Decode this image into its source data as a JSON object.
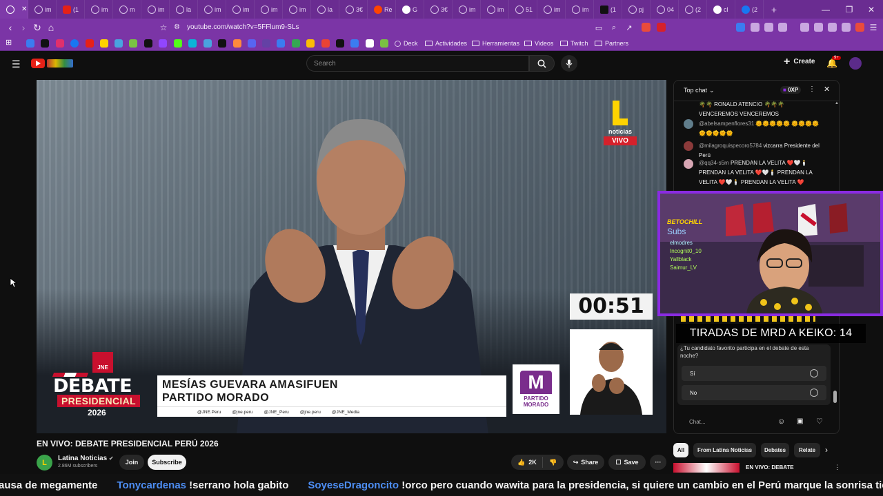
{
  "browser": {
    "tabs": [
      {
        "label": "",
        "icon": "app-icon",
        "active": true
      },
      {
        "label": "im",
        "icon": "globe-icon"
      },
      {
        "label": "(1",
        "icon": "youtube-icon"
      },
      {
        "label": "im",
        "icon": "globe-icon"
      },
      {
        "label": "m",
        "icon": "globe-icon"
      },
      {
        "label": "im",
        "icon": "globe-icon"
      },
      {
        "label": "la",
        "icon": "globe-icon"
      },
      {
        "label": "im",
        "icon": "globe-icon"
      },
      {
        "label": "im",
        "icon": "globe-icon"
      },
      {
        "label": "im",
        "icon": "globe-icon"
      },
      {
        "label": "im",
        "icon": "globe-icon"
      },
      {
        "label": "la",
        "icon": "globe-icon"
      },
      {
        "label": "3€",
        "icon": "globe-icon"
      },
      {
        "label": "Re",
        "icon": "reddit-icon"
      },
      {
        "label": "G",
        "icon": "google-icon"
      },
      {
        "label": "3€",
        "icon": "globe-icon"
      },
      {
        "label": "im",
        "icon": "globe-icon"
      },
      {
        "label": "im",
        "icon": "globe-icon"
      },
      {
        "label": "51",
        "icon": "globe-icon"
      },
      {
        "label": "im",
        "icon": "globe-icon"
      },
      {
        "label": "im",
        "icon": "globe-icon"
      },
      {
        "label": "(1",
        "icon": "x-icon"
      },
      {
        "label": "pj",
        "icon": "chat-icon"
      },
      {
        "label": "04",
        "icon": "globe-icon"
      },
      {
        "label": "(2",
        "icon": "chat-icon"
      },
      {
        "label": "cl",
        "icon": "google-icon"
      },
      {
        "label": "(2",
        "icon": "facebook-icon"
      }
    ],
    "url": "youtube.com/watch?v=5FFlum9-SLs",
    "bookmarks": [
      "Deck",
      "Actividades",
      "Herramientas",
      "Videos",
      "Twitch",
      "Partners"
    ]
  },
  "youtube": {
    "search_placeholder": "Search",
    "create_label": "Create",
    "notif_badge": "9+"
  },
  "video": {
    "channel_logo_text": "noticias",
    "live_badge": "VIVO",
    "timer": "00:51",
    "badge_line1": "DEBATE",
    "badge_line2": "PRESIDENCIAL",
    "badge_line3": "2026",
    "jne": "JNE",
    "speaker_name": "MESÍAS GUEVARA AMASIFUEN",
    "speaker_party": "PARTIDO MORADO",
    "socials": [
      "@JNE.Peru",
      "@jne.peru",
      "@JNE_Peru",
      "@jne.peru",
      "@JNE_Media"
    ],
    "party_logo_letter": "M",
    "party_logo_text_1": "PARTIDO",
    "party_logo_text_2": "MORADO"
  },
  "meta": {
    "title": "EN VIVO: DEBATE PRESIDENCIAL PERÚ 2026",
    "channel": "Latina Noticias",
    "subscribers": "2.86M subscribers",
    "join": "Join",
    "subscribe": "Subscribe",
    "likes": "2K",
    "share": "Share",
    "save": "Save"
  },
  "chat": {
    "header": "Top chat",
    "points": "0XP",
    "messages": [
      {
        "user": "",
        "text": "🌴🌴 RONALD ATENCIO 🌴🌴🌴 VENCEREMOS VENCEREMOS"
      },
      {
        "user": "@abelsampenflores31",
        "text": "🌞🌞🌞🌞🌞 🌞🌞🌞🌞🌞🌞🌞🌞🌞"
      },
      {
        "user": "@milagroquispecoro5784",
        "text": "vizcarra Presidente del Perú"
      },
      {
        "user": "@qq34-s5m",
        "text": "PRENDAN LA VELITA ❤️🤍🕯️ PRENDAN LA VELITA ❤️🤍🕯️ PRENDAN LA VELITA ❤️🤍🕯️ PRENDAN LA VELITA ❤️"
      }
    ],
    "poll_question": "¿Tu candidato favorito participa en el debate de esta noche?",
    "poll_options": [
      "Sí",
      "No"
    ],
    "input_placeholder": "Chat..."
  },
  "overlay": {
    "webcam_brand": "BETOCHILL",
    "webcam_subs_title": "Subs",
    "webcam_subs": [
      "elmodres",
      "Incognit0_10",
      "Yallblack",
      "Saimur_LV"
    ],
    "caption": "TIRADAS DE MRD A KEIKO: 14"
  },
  "related": {
    "chips": [
      "All",
      "From Latina Noticias",
      "Debates",
      "Relate"
    ],
    "first_title": "EN VIVO: DEBATE"
  },
  "ticker": [
    {
      "user": "",
      "text": "ausa de megamente"
    },
    {
      "user": "Tonycardenas",
      "text": "!serrano hola gabito"
    },
    {
      "user": "SoyeseDragoncito",
      "text": "!orco pero cuando wawita para la presidencia, si quiere un cambio en el Perú marque la sonrisa tiernita"
    }
  ],
  "colors": {
    "browser_chrome": "#7b35a6",
    "tab_strip": "#6a2c91",
    "live_red": "#d6212b",
    "party_purple": "#7a2d8c",
    "webcam_border": "#8a2be2",
    "ticker_user": "#4d8df2"
  }
}
